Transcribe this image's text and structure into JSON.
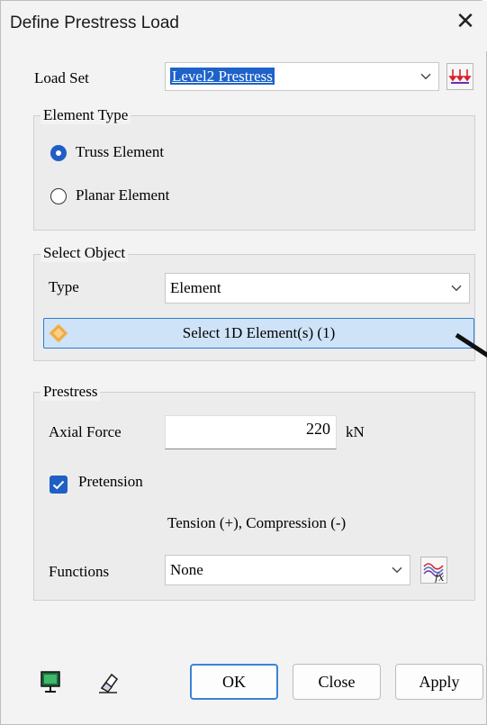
{
  "title": "Define Prestress Load",
  "close_glyph": "✕",
  "load_set": {
    "label": "Load Set",
    "value": "Level2 Prestress"
  },
  "element_type": {
    "title": "Element Type",
    "options": [
      {
        "label": "Truss Element",
        "selected": true
      },
      {
        "label": "Planar Element",
        "selected": false
      }
    ]
  },
  "select_object": {
    "title": "Select Object",
    "type_label": "Type",
    "type_value": "Element",
    "select_button": "Select 1D Element(s) (1)"
  },
  "prestress": {
    "title": "Prestress",
    "axial_force_label": "Axial Force",
    "axial_force_value": "220",
    "axial_force_unit": "kN",
    "pretension_label": "Pretension",
    "pretension_checked": true,
    "sign_note": "Tension (+), Compression (-)",
    "functions_label": "Functions",
    "functions_value": "None"
  },
  "buttons": {
    "ok": "OK",
    "close": "Close",
    "apply": "Apply"
  },
  "colors": {
    "accent": "#1f5fc5",
    "selection": "#cfe3f8",
    "background_lines": "#e02020"
  },
  "icons": [
    "load-set-graph-icon",
    "diamond-select-icon",
    "function-graph-icon",
    "display-icon",
    "eraser-icon",
    "chevron-down-icon"
  ]
}
